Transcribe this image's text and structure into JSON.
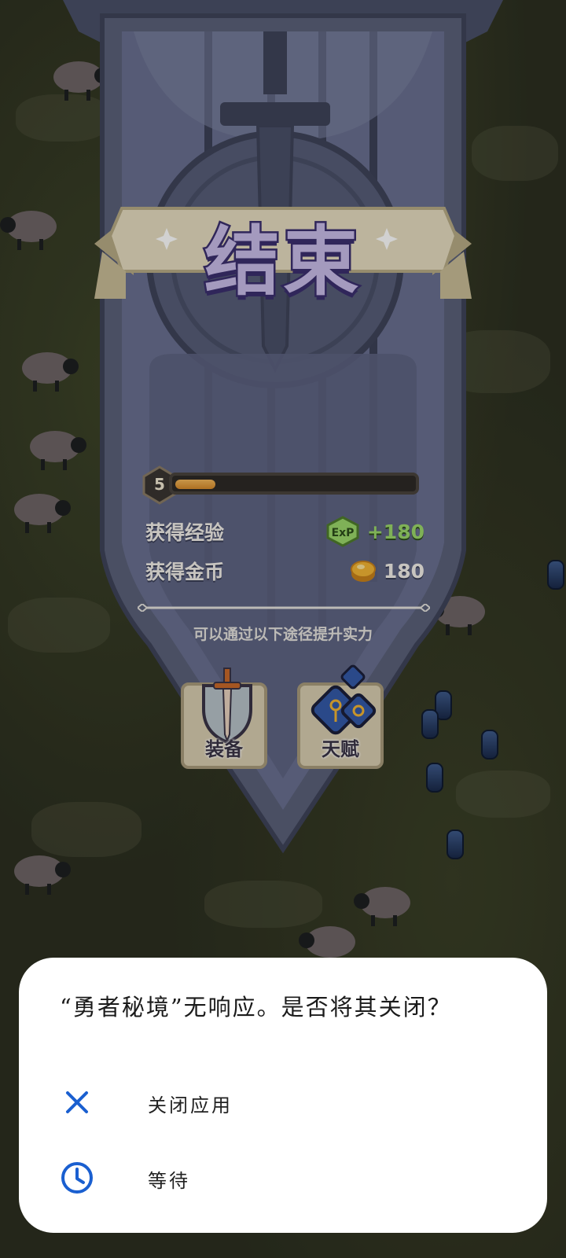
{
  "result_panel": {
    "title": "结束",
    "level": "5",
    "xp_progress": 0.17,
    "rewards": [
      {
        "label": "获得经验",
        "icon": "exp-icon",
        "value": "+180"
      },
      {
        "label": "获得金币",
        "icon": "gold-coin-icon",
        "value": "180"
      }
    ],
    "hint": "可以通过以下途径提升实力",
    "paths": [
      {
        "label": "装备",
        "icon": "sword-shield-icon"
      },
      {
        "label": "天赋",
        "icon": "talent-icon"
      }
    ],
    "exp_badge": "ExP"
  },
  "anr_dialog": {
    "message": "“勇者秘境”无响应。是否将其关闭？",
    "options": [
      {
        "label": "关闭应用",
        "icon": "close-icon"
      },
      {
        "label": "等待",
        "icon": "clock-icon"
      }
    ],
    "accent_color": "#1a5fd0"
  },
  "colors": {
    "title_fill": "#c9bce8",
    "title_stroke": "#3b2f6e",
    "exp_value": "#9bd86b",
    "banner": "#5b6179"
  }
}
